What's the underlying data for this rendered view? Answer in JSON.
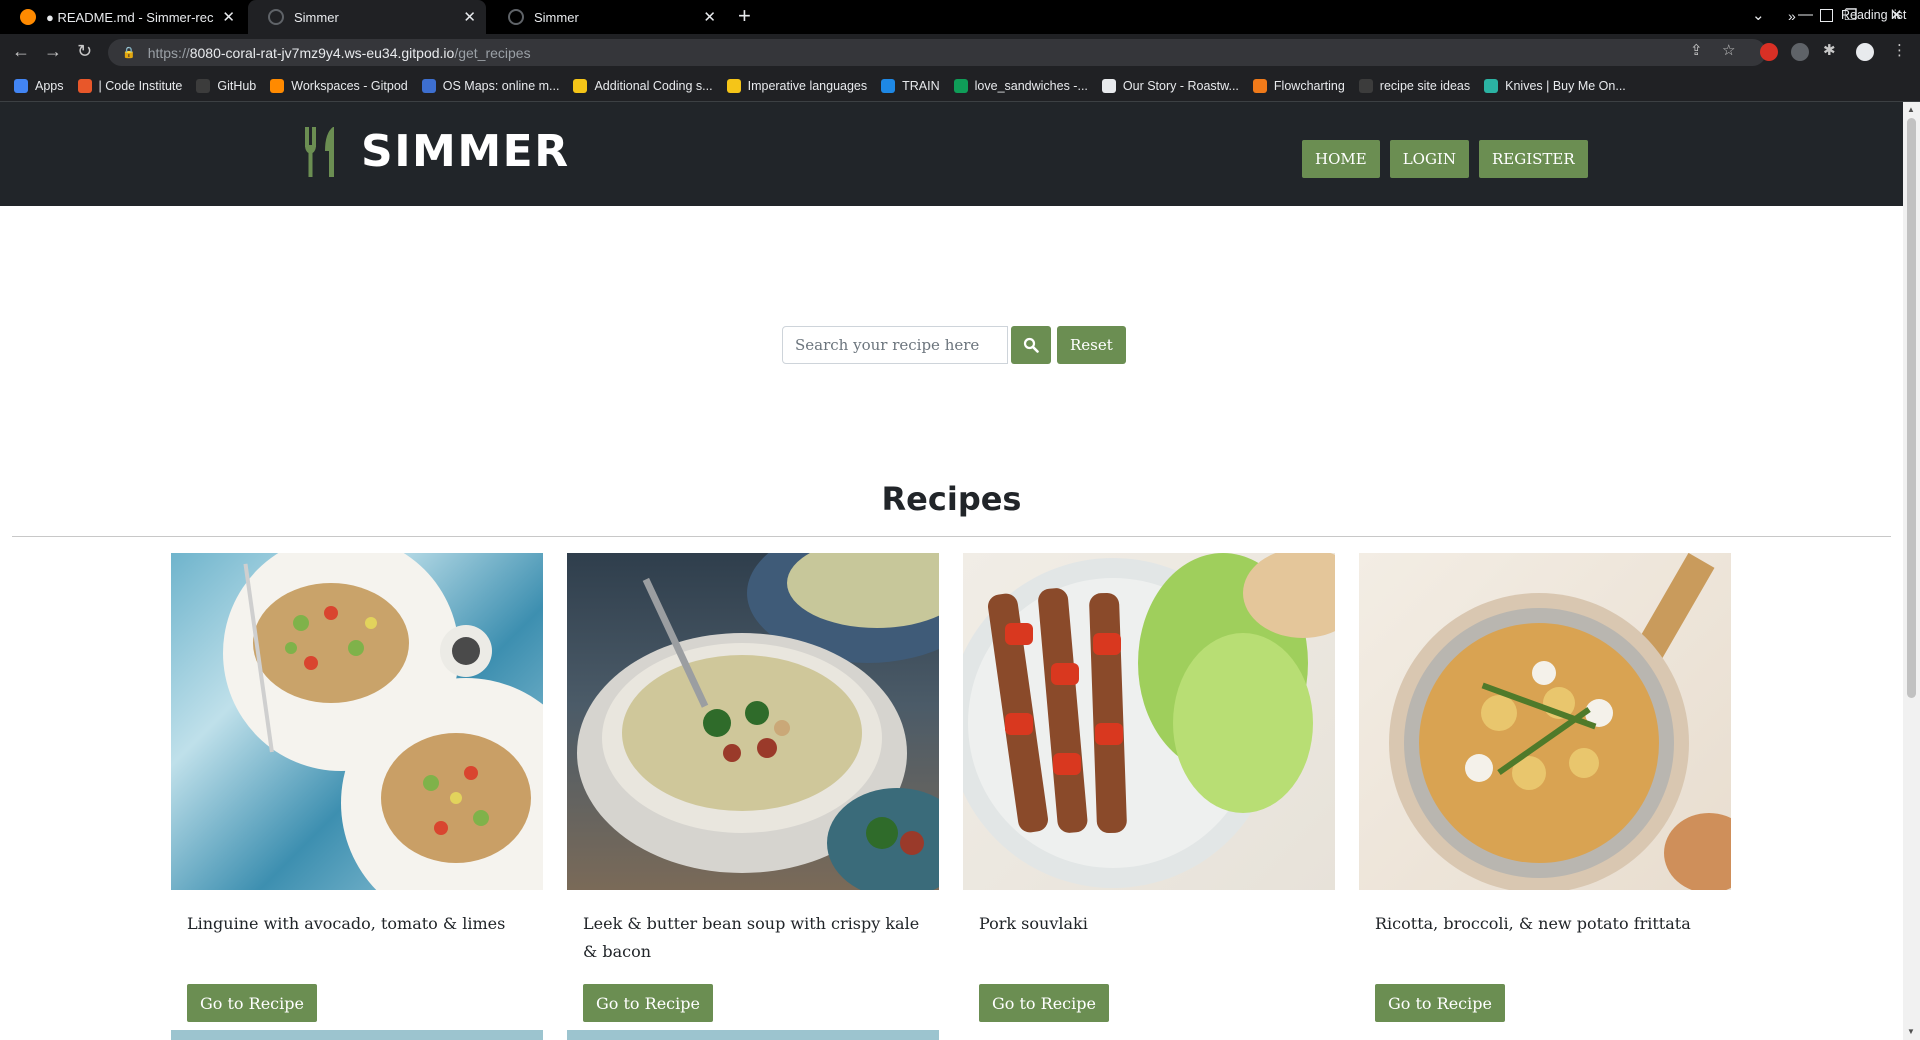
{
  "browser": {
    "tabs": [
      {
        "title": "● README.md - Simmer-recipe-",
        "active": false
      },
      {
        "title": "Simmer",
        "active": true
      },
      {
        "title": "Simmer",
        "active": false
      }
    ],
    "url": {
      "scheme": "https://",
      "host": "8080-coral-rat-jv7mz9y4.ws-eu34.gitpod.io",
      "path": "/get_recipes"
    },
    "bookmarks": [
      {
        "label": "Apps",
        "color": "#4285f4"
      },
      {
        "label": "| Code Institute",
        "color": "#e8572a"
      },
      {
        "label": "GitHub",
        "color": "#3c3c3c"
      },
      {
        "label": "Workspaces - Gitpod",
        "color": "#ff8a00"
      },
      {
        "label": "OS Maps: online m...",
        "color": "#3d6fd0"
      },
      {
        "label": "Additional Coding s...",
        "color": "#f5c518"
      },
      {
        "label": "Imperative languages",
        "color": "#f5c518"
      },
      {
        "label": "TRAIN",
        "color": "#1e88e5"
      },
      {
        "label": "love_sandwiches -...",
        "color": "#0f9d58"
      },
      {
        "label": "Our Story - Roastw...",
        "color": "#e8eaed"
      },
      {
        "label": "Flowcharting",
        "color": "#f07a1a"
      },
      {
        "label": "recipe site ideas",
        "color": "#3c3c3c"
      },
      {
        "label": "Knives | Buy Me On...",
        "color": "#2bb3a3"
      }
    ],
    "more_bookmarks": "»",
    "reading_list": "Reading list"
  },
  "site": {
    "brand": "SIMMER",
    "nav": [
      "HOME",
      "LOGIN",
      "REGISTER"
    ],
    "search_placeholder": "Search your recipe here",
    "reset_label": "Reset",
    "section_title": "Recipes",
    "accent": "#6b8e52",
    "recipes": [
      {
        "title": "Linguine with avocado, tomato & limes",
        "button": "Go to Recipe"
      },
      {
        "title": "Leek & butter bean soup with crispy kale & bacon",
        "button": "Go to Recipe"
      },
      {
        "title": "Pork souvlaki",
        "button": "Go to Recipe"
      },
      {
        "title": "Ricotta, broccoli, & new potato frittata",
        "button": "Go to Recipe"
      }
    ]
  }
}
